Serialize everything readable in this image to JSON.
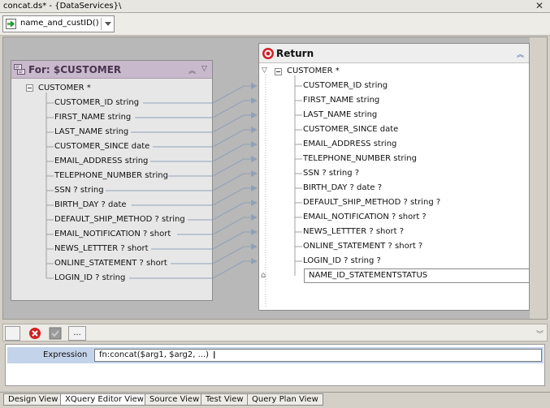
{
  "window": {
    "title": "concat.ds* - {DataServices}\\",
    "close_label": "✕"
  },
  "toolbar": {
    "function_name": "name_and_custID()"
  },
  "for_panel": {
    "title": "For: $CUSTOMER",
    "root": "CUSTOMER *",
    "fields": [
      "CUSTOMER_ID  string",
      "FIRST_NAME  string",
      "LAST_NAME  string",
      "CUSTOMER_SINCE  date",
      "EMAIL_ADDRESS  string",
      "TELEPHONE_NUMBER  string",
      "SSN ?  string",
      "BIRTH_DAY ?  date",
      "DEFAULT_SHIP_METHOD ?  string",
      "EMAIL_NOTIFICATION ?  short",
      "NEWS_LETTTER ?  short",
      "ONLINE_STATEMENT ?  short",
      "LOGIN_ID ?  string"
    ]
  },
  "return_panel": {
    "title": "Return",
    "root": "CUSTOMER *",
    "fields": [
      "CUSTOMER_ID  string",
      "FIRST_NAME  string",
      "LAST_NAME  string",
      "CUSTOMER_SINCE  date",
      "EMAIL_ADDRESS  string",
      "TELEPHONE_NUMBER  string",
      "SSN ?  string ?",
      "BIRTH_DAY ?  date ?",
      "DEFAULT_SHIP_METHOD ?  string ?",
      "EMAIL_NOTIFICATION ?  short ?",
      "NEWS_LETTTER ?  short ?",
      "ONLINE_STATEMENT ?  short ?",
      "LOGIN_ID ?  string ?"
    ],
    "new_node": "NAME_ID_STATEMENTSTATUS"
  },
  "expression": {
    "label": "Expression",
    "value": "fn:concat($arg1, $arg2, ...)",
    "more_button": "..."
  },
  "tabs": [
    {
      "label": "Design View",
      "active": false
    },
    {
      "label": "XQuery Editor View",
      "active": true
    },
    {
      "label": "Source View",
      "active": false
    },
    {
      "label": "Test View",
      "active": false
    },
    {
      "label": "Query Plan View",
      "active": false
    }
  ],
  "colors": {
    "for_header": "#c9b9cc",
    "canvas": "#b8b8b8",
    "wire": "#8fa0b8",
    "delete_icon": "#d02020",
    "return_icon": "#d0202a"
  }
}
